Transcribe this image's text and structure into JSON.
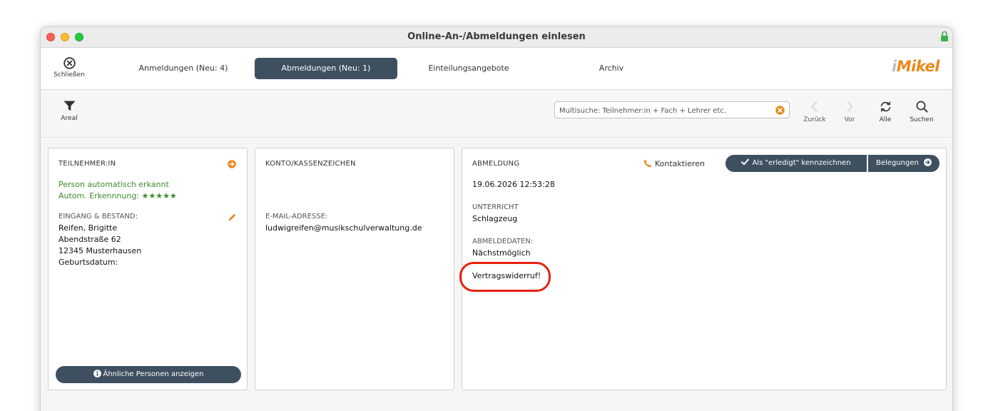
{
  "window": {
    "title": "Online-An-/Abmeldungen einlesen"
  },
  "tabbar": {
    "close_label": "Schließen",
    "tabs": [
      {
        "label": "Anmeldungen (Neu: 4)",
        "active": false
      },
      {
        "label": "Abmeldungen (Neu: 1)",
        "active": true
      },
      {
        "label": "Einteilungsangebote",
        "active": false
      },
      {
        "label": "Archiv",
        "active": false
      }
    ],
    "logo_i": "i",
    "logo_rest": "Mikel"
  },
  "toolbar": {
    "filter_label": "Areal",
    "search_placeholder": "Multisuche: Teilnehmer:in + Fach + Lehrer etc.",
    "back_label": "Zurück",
    "forward_label": "Vor",
    "all_label": "Alle",
    "search_label": "Suchen"
  },
  "participant": {
    "header": "TEILNEHMER:IN",
    "recognized": "Person automatisch erkannt",
    "recognition": "Autom. Erkennnung: ★★★★★",
    "section_label": "EINGANG & BESTAND:",
    "name": "Reifen, Brigitte",
    "street": "Abendstraße 62",
    "city": "12345 Musterhausen",
    "birthdate_label": "Geburtsdatum:",
    "similar_button": "Ähnliche Personen anzeigen"
  },
  "account": {
    "header": "KONTO/KASSENZEICHEN",
    "email_label": "E-MAIL-ADRESSE:",
    "email": "ludwigreifen@musikschulverwaltung.de"
  },
  "cancellation": {
    "header": "ABMELDUNG",
    "contact_label": "Kontaktieren",
    "done_button": "Als \"erledigt\" kennzeichnen",
    "bookings_button": "Belegungen",
    "datetime": "19.06.2026 12:53:28",
    "lesson_label": "UNTERRICHT",
    "lesson_value": "Schlagzeug",
    "dates_label": "ABMELDEDATEN:",
    "dates_value": "Nächstmöglich",
    "note": "Vertragswiderruf!"
  },
  "colors": {
    "accent_dark": "#3e5060",
    "brand_orange": "#e8891c",
    "recognized_green": "#3f8a2b",
    "highlight_red": "#e8220f"
  }
}
